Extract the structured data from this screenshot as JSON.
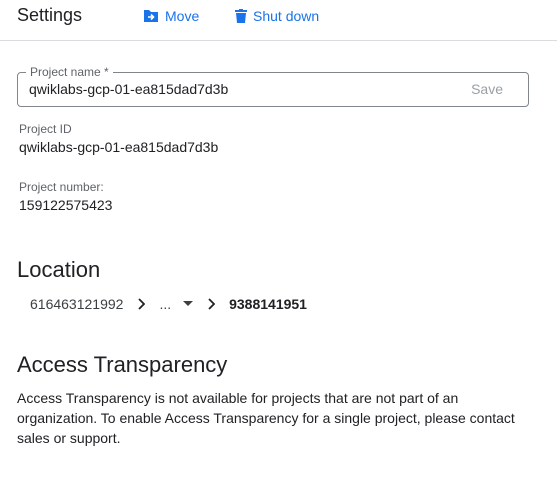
{
  "header": {
    "title": "Settings",
    "move_label": "Move",
    "shutdown_label": "Shut down"
  },
  "project_name_field": {
    "label": "Project name *",
    "value": "qwiklabs-gcp-01-ea815dad7d3b",
    "save_label": "Save"
  },
  "project_id": {
    "label": "Project ID",
    "value": "qwiklabs-gcp-01-ea815dad7d3b"
  },
  "project_number": {
    "label": "Project number:",
    "value": "159122575423"
  },
  "location": {
    "heading": "Location",
    "crumbs": [
      "616463121992",
      "...",
      "9388141951"
    ]
  },
  "access_transparency": {
    "heading": "Access Transparency",
    "text": "Access Transparency is not available for projects that are not part of an organization. To enable Access Transparency for a single project, please contact sales or support."
  },
  "colors": {
    "accent": "#1a73e8",
    "text": "#202124",
    "muted": "#5f6368",
    "border": "#80868b"
  },
  "icons": {
    "move": "move-folder-icon",
    "shutdown": "trash-icon",
    "chevron": "chevron-right-icon",
    "caret": "arrow-drop-down-icon"
  }
}
